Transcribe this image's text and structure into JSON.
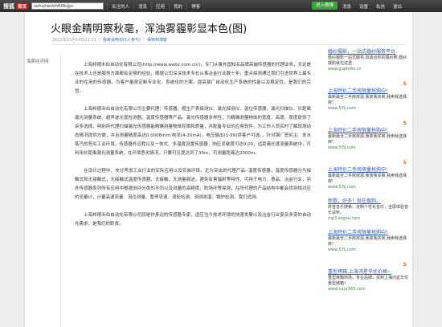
{
  "topbar": {
    "logo": "搜狐",
    "logo_badge": "首页",
    "address": "sohuhecbh60b@s",
    "nav": [
      "关注的人",
      "消息",
      "应用",
      "我的",
      "博客"
    ],
    "enter_button": "进入微博",
    "right_nav": [
      "消息",
      "设置",
      "私信",
      "退出"
    ]
  },
  "article": {
    "title": "火眼金睛明察秋毫，浑浊雾霾彰显本色(图)",
    "date": "2013年03月14日11:21",
    "reads_link": "我来说两句(5人参与)",
    "share_link": "保存到博客",
    "left_label": "海索经济网",
    "paragraphs": [
      "上海邦德禾伯自动化有限公司(http://www.webz.com.cn/)，专门从事外国知名品牌高端传感器的代理业务，天论是在技术上还是服务方面都有足够的经验，顺德公司深深技术专长从事冶金行业数十年，重点探测通过我们引进世界上最专业的在用的传感器，为客户量身定制专业化、系统化的方案，提高钢厂自动化生产系统的性能以及稳定性，是我们的宗旨。",
      "上海邦德禾伯自动化有限公司主要代理：传感器、粗生产表探测仪、激光探测仪、温位传感器、激光扫描仪、长距离激光测量系统、超声波长度检测器、温度传感器等产品。激光传感器多样性，为精确测量物体的宽度、高度、厚度提供了诉多选择，特别所代理扫描激光传感器能精确测量物体轮廓和质量，并配备专业的应用软件，为工作人员实时了解现场动态情况提供方便，并且测量精度高达0.0008mm,电流(4-20mA)、电压输出(1-99)供客户可选。，针对钢厂恶劣尘、多水蒸汽的恶劣工业环境，传感器外远程以及一体式、多温度设置传感器，响应灵敏度可达0.00，远距离长度测量系统中，可利用长距离激光测量系统，在环境恶劣情况，只要可见度达到了30m，可测量距离达2000m。",
      "在设计过程中，充分考虑工业行业的实际应用以及安装环境，尤为突出的代理产品--温度传感器，温度传感器分为接触式和无接触式，无接触式温度传感器，无接触，无测量痕迹，避免有害辐射等特性，可用于电力、食品、冶金行业，另外传感器系列所有应用中根据测评分类的不同以及测量的高精度，防场环等探测，在所代理的产品结构中都会找到相对应的流量计，计量高速流量、流位测量、暂停流速、涡轮检测、测测测温、锅炉检测，我们适测。",
      "上海邦德禾伯自动化有限公司就是作身边的传感器专家，适应当今技术环境的快速发展以及冶金行业复杂多变的自动化需求，是我们的职责。"
    ]
  },
  "ads": [
    {
      "title": "婚纱摄影，一站式婚纱服务平台",
      "desc": "婚纱摄影一站式服务,找适合你的婚纱照,婚纱摄影就在这里",
      "url": "www.guphoto.cn"
    },
    {
      "title": "上海特价二手房限量抢购中!",
      "desc": "最新最全二手房房源,我变我买房,我卖我选择房!",
      "url": "www.5i5j.com"
    },
    {
      "title": "上海特价二手房限量抢购中!",
      "desc": "最新最全二手房房源,我变我买房,我卖我选择房!",
      "url": "www.5i5j.com"
    },
    {
      "title": "上海特价二手房限量抢购中!",
      "desc": "最新最全二手房房源,我变我买房,我卖我选择房!",
      "url": "www.5i5j.com"
    },
    {
      "title": "新歌，好多！就在搜狗。",
      "desc": "拼音音乐搜索，定制个性化音乐，全屏体验音乐试听。",
      "url": "mp3.sogou.com"
    },
    {
      "title": "上海特价二手房限量抢购中!",
      "desc": "最新最全二手房房源,我变我买房,我卖我选择房!",
      "url": "www.5i5j.com"
    },
    {
      "title": "重型烤箱,上海鸿星华优价格~",
      "desc": "重型烤箱商场，专业品牌，找到上海鸿星华优重型烤箱！",
      "url": "www.hzzy365.com"
    }
  ]
}
